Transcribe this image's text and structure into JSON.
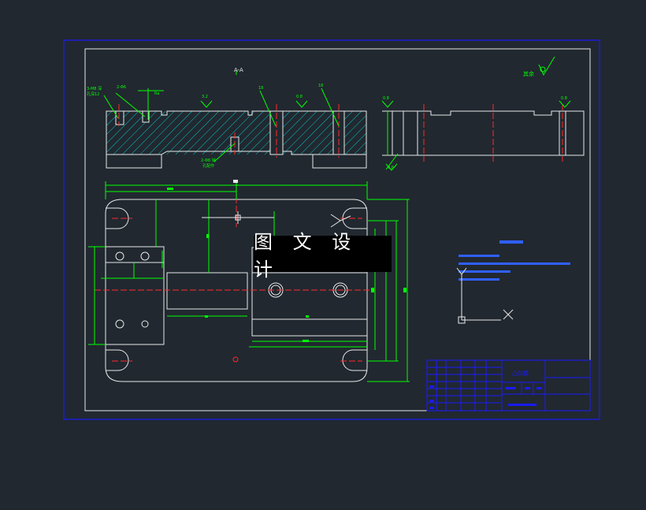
{
  "watermark": {
    "text": "图 文 设 计"
  },
  "title_block": {
    "drawing_title": "凸凹模"
  },
  "colors": {
    "background": "#212830",
    "outline": "#e8e8e8",
    "dimension": "#00ff00",
    "centerline": "#ff2a2a",
    "hatch": "#00c8c8",
    "frame": "#1a1aff",
    "notes": "#3060ff"
  },
  "annotations": {
    "roughness_other": "其余",
    "section_label": "A-A"
  },
  "icons": {
    "ucs": "ucs-axis-icon",
    "roughness": "roughness-symbol-icon"
  }
}
